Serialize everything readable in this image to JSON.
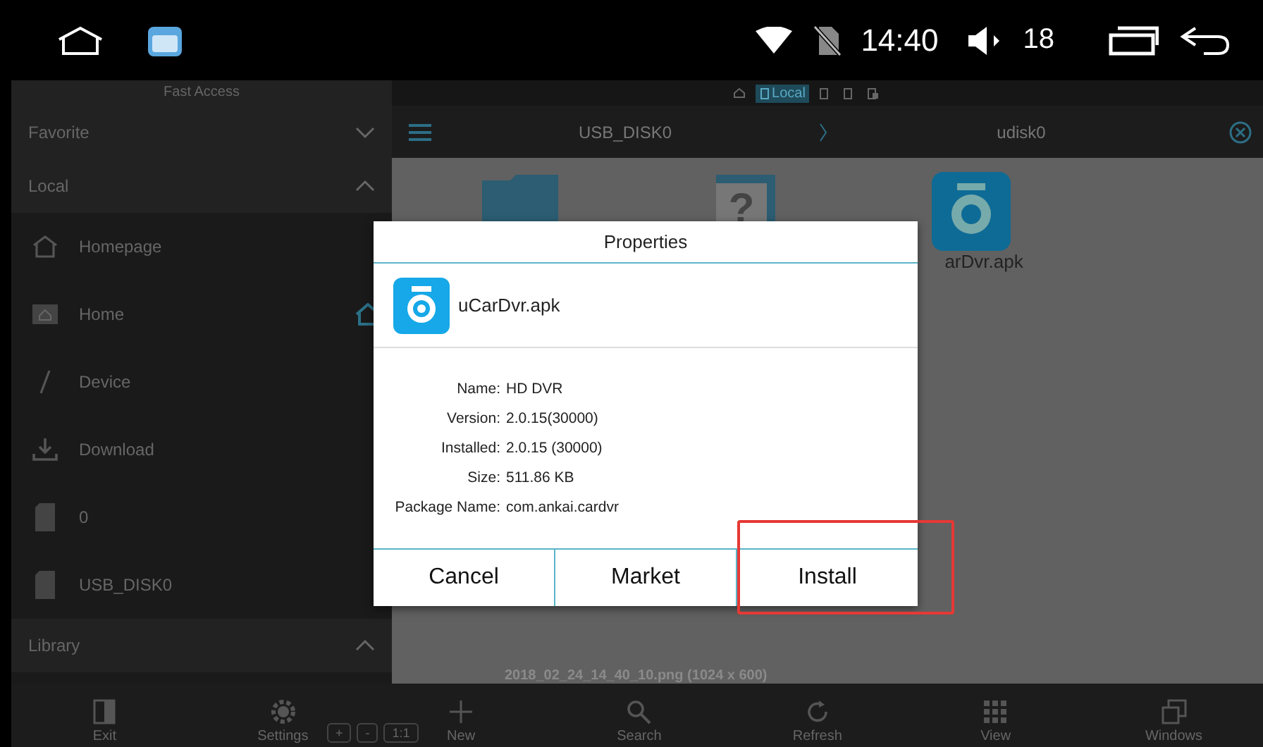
{
  "status_bar": {
    "time": "14:40",
    "volume": "18"
  },
  "fast_access": {
    "title": "Fast Access"
  },
  "location_tabs": [
    {
      "kind": "home",
      "selected": false
    },
    {
      "kind": "device",
      "label": "Local",
      "selected": true
    },
    {
      "kind": "device",
      "selected": false
    },
    {
      "kind": "device",
      "selected": false
    },
    {
      "kind": "network",
      "selected": false
    }
  ],
  "sidebar": {
    "sections": [
      {
        "title": "Favorite",
        "expanded": false
      },
      {
        "title": "Local",
        "expanded": true,
        "items": [
          {
            "kind": "homepage",
            "label": "Homepage",
            "home_marker": false
          },
          {
            "kind": "home",
            "label": "Home",
            "home_marker": true
          },
          {
            "kind": "device",
            "label": "Device",
            "home_marker": false
          },
          {
            "kind": "download",
            "label": "Download",
            "home_marker": false
          },
          {
            "kind": "sd",
            "label": "0",
            "home_marker": false
          },
          {
            "kind": "sd",
            "label": "USB_DISK0",
            "home_marker": false
          }
        ]
      },
      {
        "title": "Library",
        "expanded": true
      }
    ]
  },
  "path_bar": {
    "crumbs": [
      "USB_DISK0",
      "udisk0"
    ]
  },
  "files": [
    {
      "kind": "folder"
    },
    {
      "kind": "unknown",
      "glyph": "?"
    },
    {
      "kind": "apk",
      "name": "arDvr.apk"
    }
  ],
  "preview_caption": "2018_02_24_14_40_10.png (1024 x 600)",
  "dialog": {
    "title": "Properties",
    "file_name": "uCarDvr.apk",
    "properties": [
      {
        "label": "Name:",
        "value": "HD DVR"
      },
      {
        "label": "Version:",
        "value": "2.0.15(30000)"
      },
      {
        "label": "Installed:",
        "value": "2.0.15 (30000)"
      },
      {
        "label": "Size:",
        "value": "511.86 KB"
      },
      {
        "label": "Package Name:",
        "value": "com.ankai.cardvr"
      }
    ],
    "buttons": [
      {
        "label": "Cancel",
        "highlighted": false
      },
      {
        "label": "Market",
        "highlighted": false
      },
      {
        "label": "Install",
        "highlighted": true
      }
    ]
  },
  "toolbar": [
    {
      "kind": "exit",
      "label": "Exit"
    },
    {
      "kind": "settings",
      "label": "Settings"
    },
    {
      "kind": "new",
      "label": "New"
    },
    {
      "kind": "search",
      "label": "Search"
    },
    {
      "kind": "refresh",
      "label": "Refresh"
    },
    {
      "kind": "view",
      "label": "View"
    },
    {
      "kind": "windows",
      "label": "Windows"
    }
  ],
  "zoom_buttons": [
    "+",
    "-",
    "1:1"
  ]
}
